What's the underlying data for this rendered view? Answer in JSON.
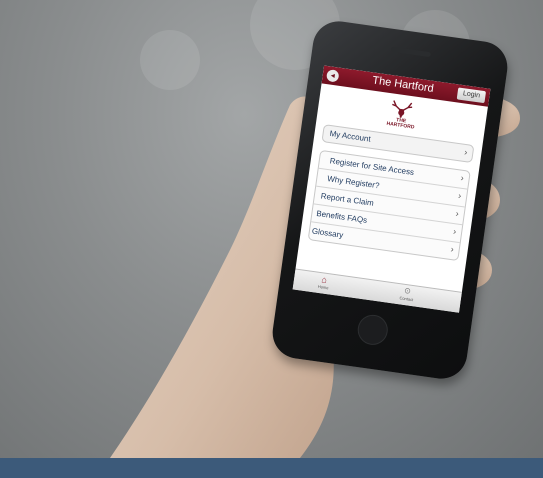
{
  "app": {
    "title": "The Hartford",
    "login_label": "Login",
    "back_icon": "back-icon",
    "logo_text_line1": "THE",
    "logo_text_line2": "HARTFORD"
  },
  "menu": {
    "account": "My Account",
    "items": [
      "Register for Site Access",
      "Why Register?",
      "Report a Claim",
      "Benefits FAQs",
      "Glossary"
    ]
  },
  "tabs": {
    "home": "Home",
    "contact": "Contact"
  },
  "colors": {
    "brand": "#8e1a2c",
    "footer_bar": "#3c5a7a",
    "link_text": "#1f3a5f"
  }
}
